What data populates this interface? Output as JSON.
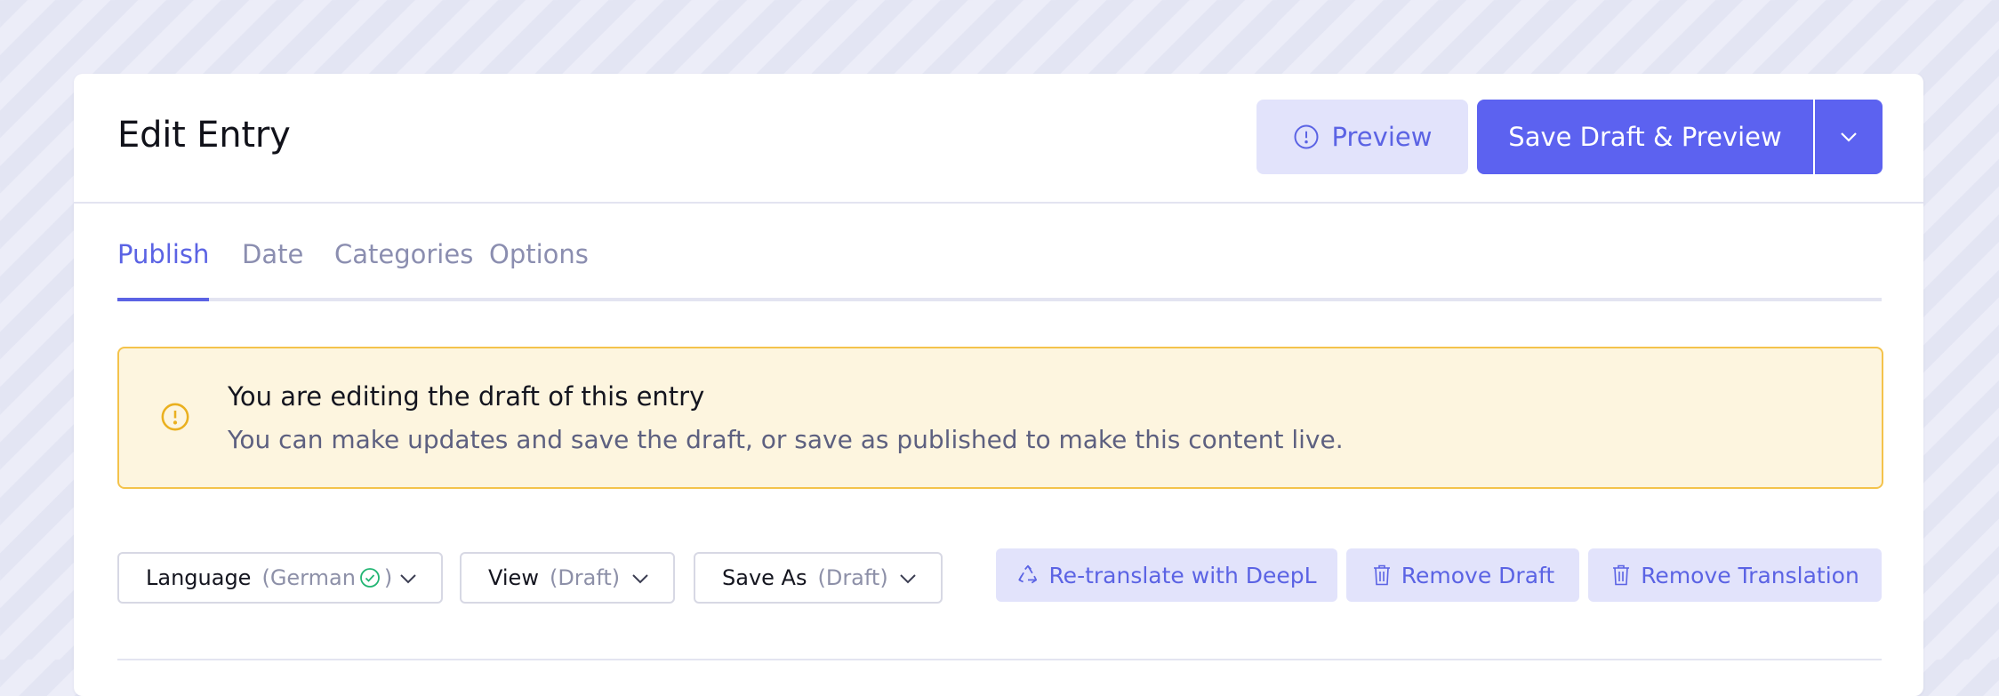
{
  "header": {
    "title": "Edit Entry",
    "preview_label": "Preview",
    "save_label": "Save Draft & Preview"
  },
  "tabs": [
    {
      "label": "Publish",
      "active": true
    },
    {
      "label": "Date",
      "active": false
    },
    {
      "label": "Categories",
      "active": false
    },
    {
      "label": "Options",
      "active": false
    }
  ],
  "notice": {
    "title": "You are editing the draft of this entry",
    "body": "You can make updates and save the draft, or save as published to make this content live."
  },
  "toolbar": {
    "language_label": "Language",
    "language_value_open": "(German",
    "language_value_close": ")",
    "view_label": "View",
    "view_value": "(Draft)",
    "save_as_label": "Save As",
    "save_as_value": "(Draft)",
    "retranslate_label": "Re-translate with DeepL",
    "remove_draft_label": "Remove Draft",
    "remove_translation_label": "Remove Translation"
  },
  "colors": {
    "accent": "#5c62f0",
    "accent_light": "#e2e3fb",
    "notice_bg": "#fdf5df",
    "notice_border": "#f4c34b",
    "success": "#22b573"
  },
  "icons": {
    "preview": "alert-circle-icon",
    "caret": "chevron-down-icon",
    "notice": "warning-circle-icon",
    "language_status": "check-circle-icon",
    "retranslate": "recycle-icon",
    "remove": "trash-icon"
  }
}
